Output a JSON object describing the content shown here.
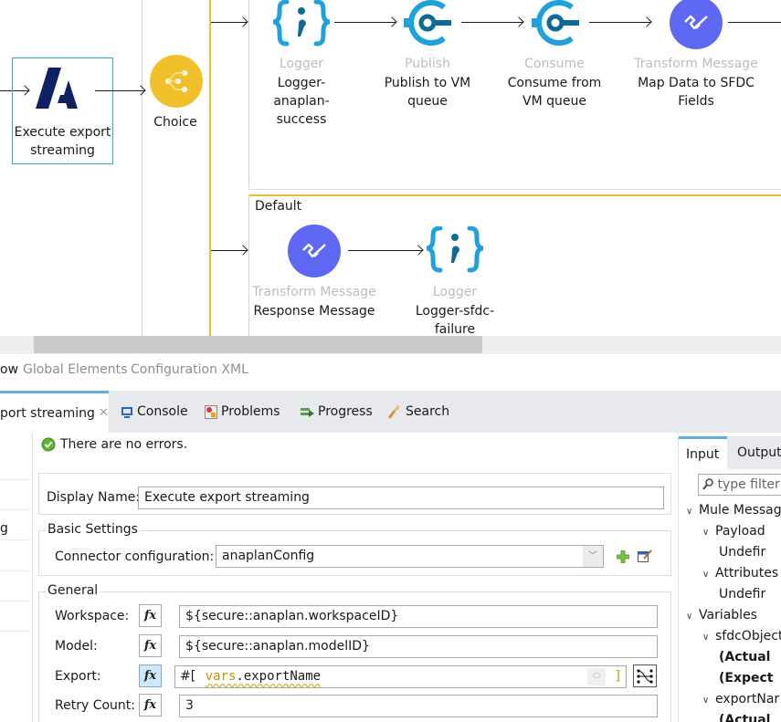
{
  "flow": {
    "source_node": {
      "type": "",
      "label": "Execute export streaming",
      "icon": "anaplan-logo-icon"
    },
    "choice_node": {
      "label": "Choice",
      "icon": "choice-router-icon",
      "color": "#f0c02a"
    },
    "when_route": [
      {
        "type": "Logger",
        "label": "Logger-anaplan-success",
        "icon": "logger-icon"
      },
      {
        "type": "Publish",
        "label": "Publish to VM queue",
        "icon": "vm-publish-icon"
      },
      {
        "type": "Consume",
        "label": "Consume from VM queue",
        "icon": "vm-consume-icon"
      },
      {
        "type": "Transform Message",
        "label": "Map Data to SFDC Fields",
        "icon": "transform-message-icon"
      }
    ],
    "default_route": {
      "title": "Default",
      "nodes": [
        {
          "type": "Transform Message",
          "label": "Response Message",
          "icon": "transform-message-icon"
        },
        {
          "type": "Logger",
          "label": "Logger-sfdc-failure",
          "icon": "logger-icon"
        }
      ]
    },
    "colors": {
      "accent_blue": "#1fa1dc",
      "dark_blue": "#0f6b94",
      "transform_purple": "#5f68f2",
      "anaplan_navy": "#0d2163",
      "route_yellow": "#f0c02a"
    }
  },
  "editor_tabs": [
    "ow",
    "Global Elements",
    "Configuration XML"
  ],
  "panel_tabs": [
    {
      "label": "port streaming",
      "icon": "",
      "active": true,
      "closable": true
    },
    {
      "label": "Console",
      "icon": "console-icon"
    },
    {
      "label": "Problems",
      "icon": "problems-icon"
    },
    {
      "label": "Progress",
      "icon": "progress-icon"
    },
    {
      "label": "Search",
      "icon": "search-icon"
    }
  ],
  "left_list": {
    "visible_text": "g"
  },
  "properties": {
    "status": "There are no errors.",
    "display_name_label": "Display Name:",
    "display_name_value": "Execute export streaming",
    "basic_settings": {
      "title": "Basic Settings",
      "connector_label": "Connector configuration:",
      "connector_value": "anaplanConfig"
    },
    "general": {
      "title": "General",
      "workspace_label": "Workspace:",
      "workspace_value": "${secure::anaplan.workspaceID}",
      "model_label": "Model:",
      "model_value": "${secure::anaplan.modelID}",
      "export_label": "Export:",
      "export_prefix": "#[",
      "export_keyword": "vars",
      "export_rest": ".exportName",
      "export_suffix": "]",
      "retry_label": "Retry Count:",
      "retry_value": "3",
      "fx_label": "fx"
    }
  },
  "metadata_panel": {
    "tabs": [
      "Input",
      "Output"
    ],
    "filter_placeholder": "type filter t",
    "tree": [
      {
        "label": "Mule Messag",
        "level": 0,
        "expanded": true
      },
      {
        "label": "Payload",
        "level": 1,
        "expanded": true
      },
      {
        "label": "Undefir",
        "level": 2
      },
      {
        "label": "Attributes",
        "level": 1,
        "expanded": true
      },
      {
        "label": "Undefir",
        "level": 2
      },
      {
        "label": "Variables",
        "level": 0,
        "expanded": true
      },
      {
        "label": "sfdcObject",
        "level": 1,
        "expanded": true
      },
      {
        "label": "(Actual",
        "level": 2,
        "bold": true
      },
      {
        "label": "(Expect",
        "level": 2,
        "bold": true
      },
      {
        "label": "exportNar",
        "level": 1,
        "expanded": true
      },
      {
        "label": "(Actual",
        "level": 2,
        "bold": true
      }
    ]
  }
}
